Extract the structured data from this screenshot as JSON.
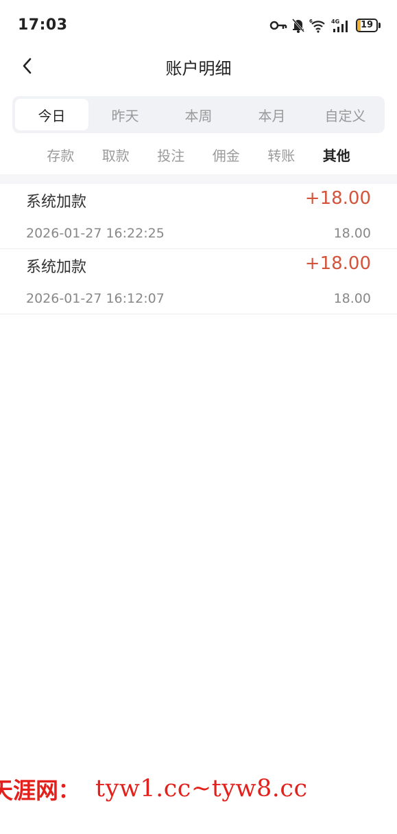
{
  "status_bar": {
    "time": "17:03",
    "battery": "19",
    "battery_level_percent": 19,
    "battery_color": "#f3b136",
    "icons": [
      "key-icon",
      "bell-off-icon",
      "wifi-icon",
      "signal-4g-icon",
      "battery-icon"
    ]
  },
  "header": {
    "back_icon": "chevron-left-icon",
    "title": "账户明细"
  },
  "period_tabs": [
    {
      "label": "今日",
      "active": true
    },
    {
      "label": "昨天",
      "active": false
    },
    {
      "label": "本周",
      "active": false
    },
    {
      "label": "本月",
      "active": false
    },
    {
      "label": "自定义",
      "active": false
    }
  ],
  "type_tabs": [
    {
      "label": "存款",
      "active": false
    },
    {
      "label": "取款",
      "active": false
    },
    {
      "label": "投注",
      "active": false
    },
    {
      "label": "佣金",
      "active": false
    },
    {
      "label": "转账",
      "active": false
    },
    {
      "label": "其他",
      "active": true
    }
  ],
  "records": [
    {
      "name": "系统加款",
      "amount": "+18.00",
      "time": "2026-01-27 16:22:25",
      "balance": "18.00"
    },
    {
      "name": "系统加款",
      "amount": "+18.00",
      "time": "2026-01-27 16:12:07",
      "balance": "18.00"
    }
  ],
  "colors": {
    "amount_positive": "#d4533b",
    "watermark": "#e3201b"
  },
  "watermark": {
    "brand": "天涯网",
    "colon": "：",
    "url": "tyw1.cc~tyw8.cc"
  }
}
